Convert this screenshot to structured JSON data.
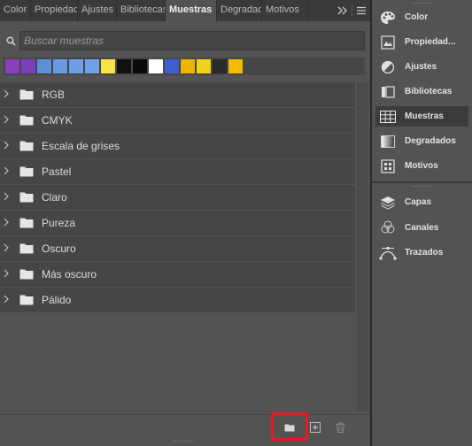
{
  "tabs": [
    {
      "label": "Color",
      "active": false
    },
    {
      "label": "Propiedades",
      "active": false
    },
    {
      "label": "Ajustes",
      "active": false
    },
    {
      "label": "Bibliotecas",
      "active": false
    },
    {
      "label": "Muestras",
      "active": true
    },
    {
      "label": "Degradados",
      "active": false
    },
    {
      "label": "Motivos",
      "active": false
    }
  ],
  "tabbar_icons": [
    "double-chevron-right-icon",
    "hamburger-menu-icon"
  ],
  "search": {
    "placeholder": "Buscar muestras",
    "value": ""
  },
  "recent_swatches": [
    "#8a3fc0",
    "#7a3fb8",
    "#5b8fd8",
    "#6a9ae0",
    "#6f9ee6",
    "#6f9fe8",
    "#f7e24a",
    "#111111",
    "#0a0a0a",
    "#ffffff",
    "#3d5fd0",
    "#f0b400",
    "#f2d218",
    "#2a2a2a",
    "#f3bc00"
  ],
  "swatch_groups": [
    {
      "label": "RGB"
    },
    {
      "label": "CMYK"
    },
    {
      "label": "Escala de grises"
    },
    {
      "label": "Pastel"
    },
    {
      "label": "Claro"
    },
    {
      "label": "Pureza"
    },
    {
      "label": "Oscuro"
    },
    {
      "label": "Más oscuro"
    },
    {
      "label": "Pálido"
    }
  ],
  "bottom_actions": [
    "new-group-icon",
    "new-swatch-icon",
    "trash-icon"
  ],
  "highlight_color": "#e8191f",
  "right_panel": {
    "group1": [
      {
        "label": "Color",
        "icon": "palette-icon",
        "active": false
      },
      {
        "label": "Propiedad...",
        "icon": "properties-icon",
        "active": false
      },
      {
        "label": "Ajustes",
        "icon": "adjustments-icon",
        "active": false
      },
      {
        "label": "Bibliotecas",
        "icon": "libraries-icon",
        "active": false
      },
      {
        "label": "Muestras",
        "icon": "swatches-grid-icon",
        "active": true
      },
      {
        "label": "Degradados",
        "icon": "gradient-icon",
        "active": false
      },
      {
        "label": "Motivos",
        "icon": "patterns-icon",
        "active": false
      }
    ],
    "group2": [
      {
        "label": "Capas",
        "icon": "layers-icon",
        "active": false
      },
      {
        "label": "Canales",
        "icon": "channels-icon",
        "active": false
      },
      {
        "label": "Trazados",
        "icon": "paths-icon",
        "active": false
      }
    ]
  }
}
